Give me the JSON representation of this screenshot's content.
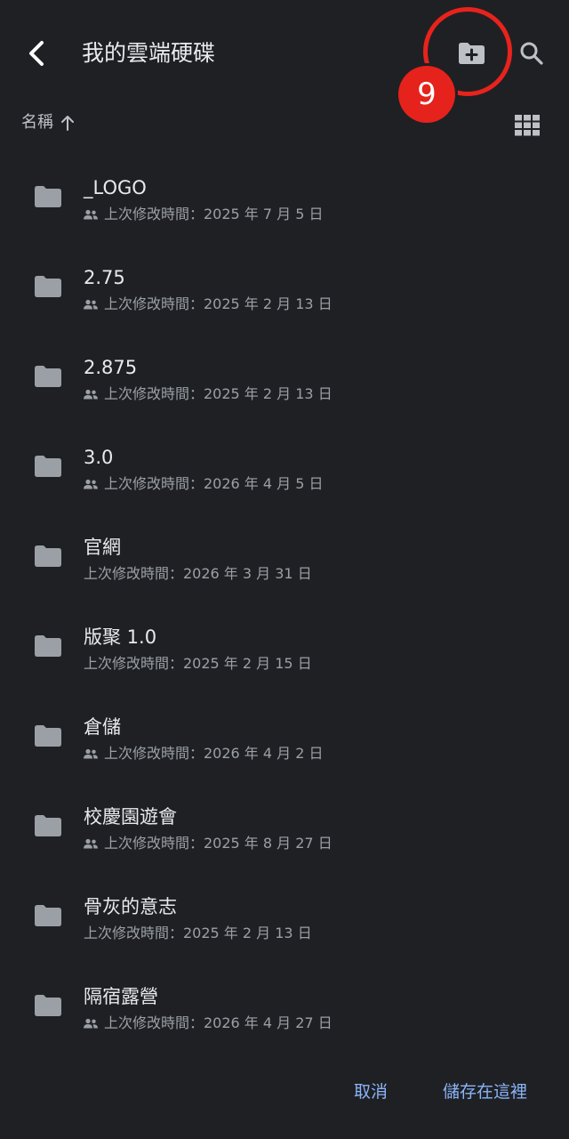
{
  "header": {
    "title": "我的雲端硬碟",
    "back_icon": "chevron-left-icon",
    "new_folder_icon": "create-folder-icon",
    "search_icon": "search-icon"
  },
  "annotation": {
    "step_number": "9",
    "color": "#e5221b"
  },
  "sort": {
    "label": "名稱",
    "direction": "ascending",
    "view_toggle_icon": "grid-view-icon"
  },
  "folders": [
    {
      "name": "_LOGO",
      "shared": true,
      "modified": "上次修改時間：2025 年 7 月 5 日"
    },
    {
      "name": "2.75",
      "shared": true,
      "modified": "上次修改時間：2025 年 2 月 13 日"
    },
    {
      "name": "2.875",
      "shared": true,
      "modified": "上次修改時間：2025 年 2 月 13 日"
    },
    {
      "name": "3.0",
      "shared": true,
      "modified": "上次修改時間：2026 年 4 月 5 日"
    },
    {
      "name": "官網",
      "shared": false,
      "modified": "上次修改時間：2026 年 3 月 31 日"
    },
    {
      "name": "版聚 1.0",
      "shared": false,
      "modified": "上次修改時間：2025 年 2 月 15 日"
    },
    {
      "name": "倉儲",
      "shared": true,
      "modified": "上次修改時間：2026 年 4 月 2 日"
    },
    {
      "name": "校慶園遊會",
      "shared": true,
      "modified": "上次修改時間：2025 年 8 月 27 日"
    },
    {
      "name": "骨灰的意志",
      "shared": false,
      "modified": "上次修改時間：2025 年 2 月 13 日"
    },
    {
      "name": "隔宿露營",
      "shared": true,
      "modified": "上次修改時間：2026 年 4 月 27 日"
    }
  ],
  "footer": {
    "cancel_label": "取消",
    "save_label": "儲存在這裡"
  },
  "colors": {
    "background": "#1f2024",
    "text_primary": "#e8eaed",
    "text_secondary": "#9aa0a6",
    "icon": "#9aa0a6",
    "accent": "#8ab4f8"
  }
}
